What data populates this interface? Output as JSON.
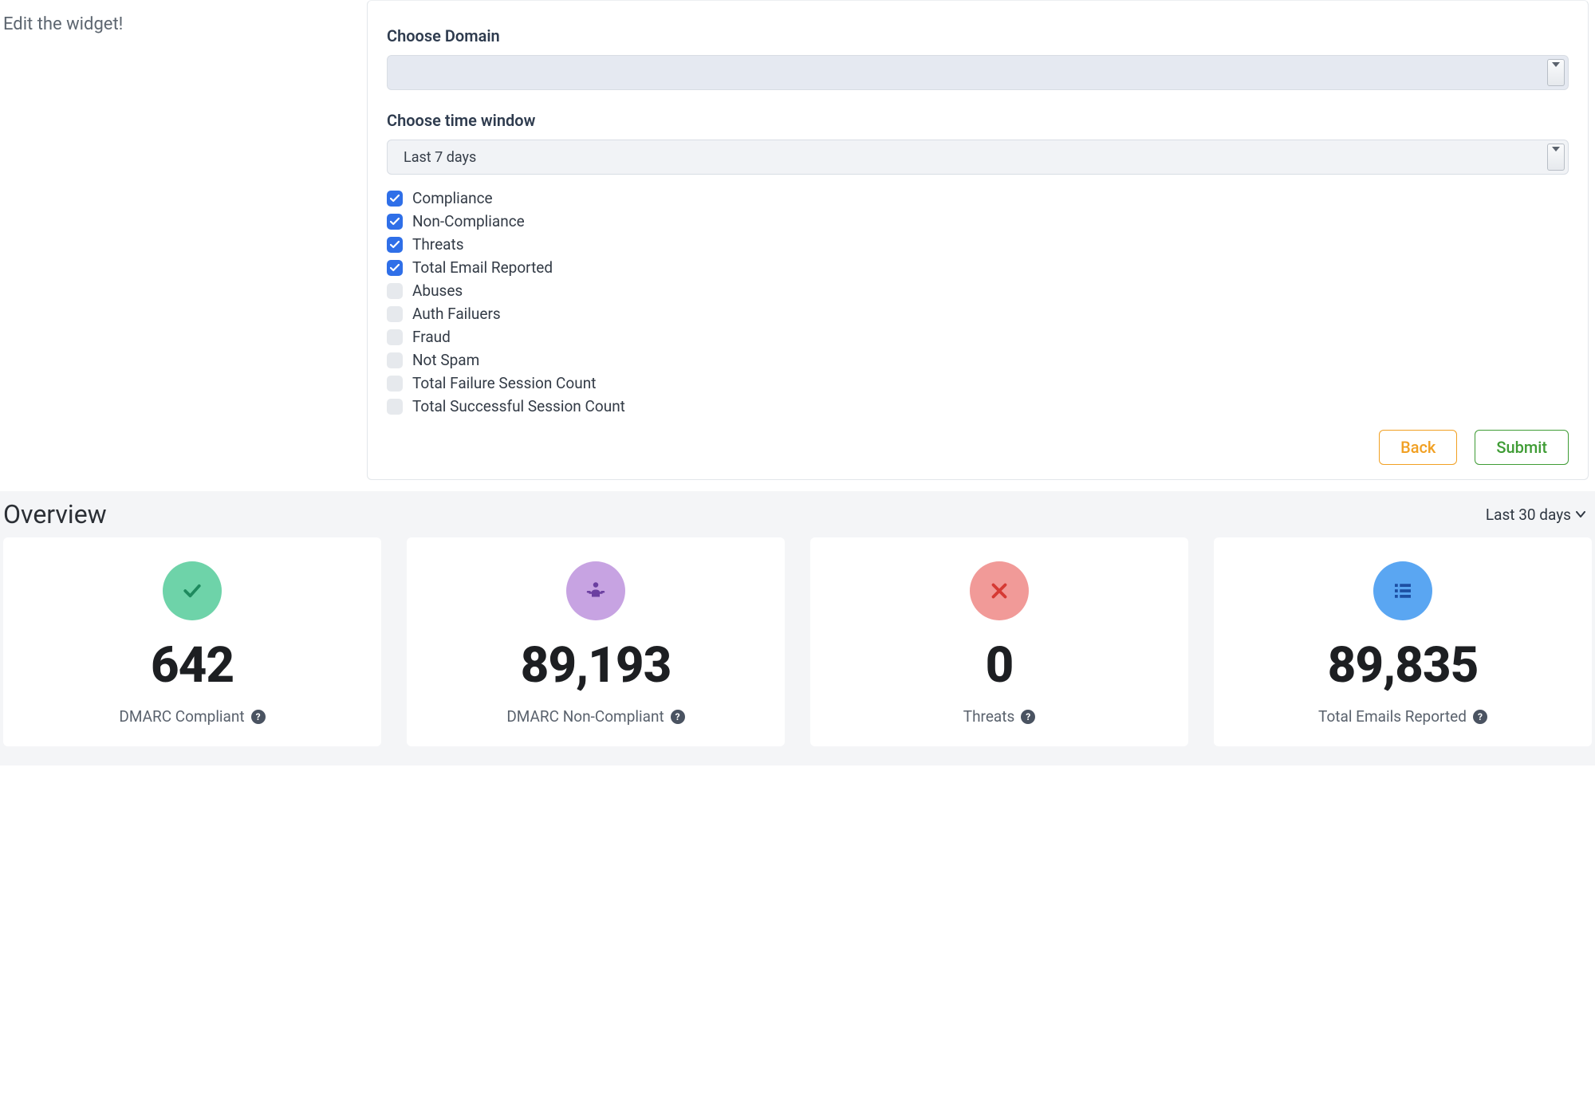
{
  "edit_label": "Edit the widget!",
  "form": {
    "domain_label": "Choose Domain",
    "domain_value": "",
    "time_label": "Choose time window",
    "time_value": "Last 7 days",
    "options": [
      {
        "label": "Compliance",
        "checked": true
      },
      {
        "label": "Non-Compliance",
        "checked": true
      },
      {
        "label": "Threats",
        "checked": true
      },
      {
        "label": "Total Email Reported",
        "checked": true
      },
      {
        "label": "Abuses",
        "checked": false
      },
      {
        "label": "Auth Failuers",
        "checked": false
      },
      {
        "label": "Fraud",
        "checked": false
      },
      {
        "label": "Not Spam",
        "checked": false
      },
      {
        "label": "Total Failure Session Count",
        "checked": false
      },
      {
        "label": "Total Successful Session Count",
        "checked": false
      }
    ],
    "back_label": "Back",
    "submit_label": "Submit"
  },
  "overview": {
    "title": "Overview",
    "range": "Last 30 days",
    "cards": [
      {
        "value": "642",
        "label": "DMARC Compliant",
        "icon": "check",
        "color": "green"
      },
      {
        "value": "89,193",
        "label": "DMARC Non-Compliant",
        "icon": "person",
        "color": "purple"
      },
      {
        "value": "0",
        "label": "Threats",
        "icon": "x",
        "color": "red"
      },
      {
        "value": "89,835",
        "label": "Total Emails Reported",
        "icon": "list",
        "color": "blue"
      }
    ]
  }
}
